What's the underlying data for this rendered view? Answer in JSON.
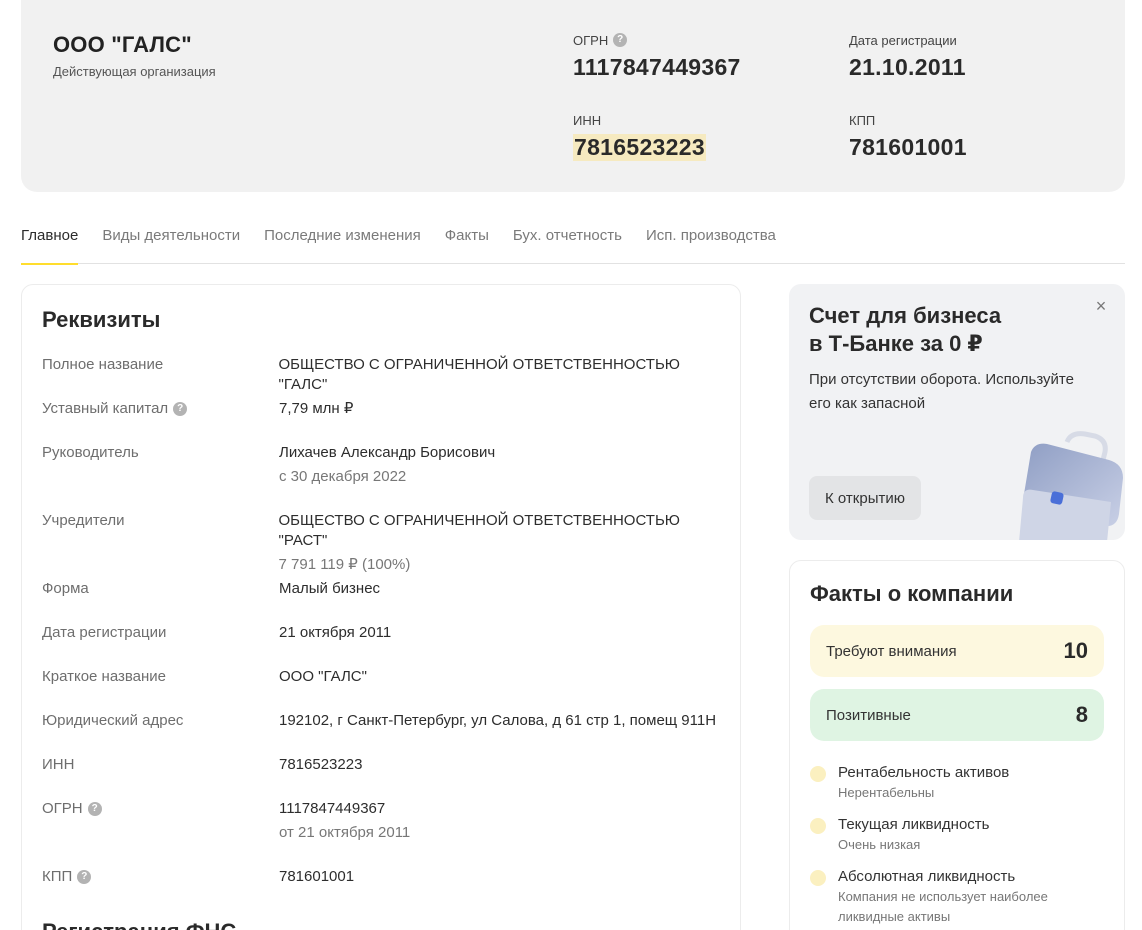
{
  "header": {
    "name": "ООО \"ГАЛС\"",
    "status": "Действующая организация",
    "ogrn_label": "ОГРН",
    "ogrn": "1117847449367",
    "reg_label": "Дата регистрации",
    "reg_date": "21.10.2011",
    "inn_label": "ИНН",
    "inn": "7816523223",
    "kpp_label": "КПП",
    "kpp": "781601001"
  },
  "tabs": [
    {
      "label": "Главное",
      "active": true
    },
    {
      "label": "Виды деятельности",
      "active": false
    },
    {
      "label": "Последние изменения",
      "active": false
    },
    {
      "label": "Факты",
      "active": false
    },
    {
      "label": "Бух. отчетность",
      "active": false
    },
    {
      "label": "Исп. производства",
      "active": false
    }
  ],
  "requisites": {
    "title": "Реквизиты",
    "rows": [
      {
        "label": "Полное название",
        "value": "ОБЩЕСТВО С ОГРАНИЧЕННОЙ ОТВЕТСТВЕННОСТЬЮ \"ГАЛС\""
      },
      {
        "label": "Уставный капитал",
        "value": "7,79 млн ₽"
      },
      {
        "label": "Руководитель",
        "value": "Лихачев Александр Борисович",
        "sub": "с 30 декабря 2022"
      },
      {
        "label": "Учредители",
        "value": "ОБЩЕСТВО С ОГРАНИЧЕННОЙ ОТВЕТСТВЕННОСТЬЮ \"РАСТ\"",
        "sub": "7 791 119 ₽ (100%)"
      },
      {
        "label": "Форма",
        "value": "Малый бизнес"
      },
      {
        "label": "Дата регистрации",
        "value": "21 октября 2011"
      },
      {
        "label": "Краткое название",
        "value": "ООО \"ГАЛС\""
      },
      {
        "label": "Юридический адрес",
        "value": "192102, г Санкт-Петербург, ул Салова, д 61 стр 1, помещ 911Н"
      },
      {
        "label": "ИНН",
        "value": "7816523223"
      },
      {
        "label": "ОГРН",
        "value": "1117847449367",
        "sub": "от 21 октября 2011"
      },
      {
        "label": "КПП",
        "value": "781601001"
      }
    ],
    "next_section": "Регистрация ФНС"
  },
  "promo": {
    "title_line1": "Счет для бизнеса",
    "title_line2": "в Т-Банке за 0 ₽",
    "text": "При отсутствии оборота. Используйте его как запасной",
    "button": "К открытию",
    "close": "×"
  },
  "facts": {
    "title": "Факты о компании",
    "attention_label": "Требуют внимания",
    "attention_count": "10",
    "positive_label": "Позитивные",
    "positive_count": "8",
    "items": [
      {
        "name": "Рентабельность активов",
        "desc": "Нерентабельны"
      },
      {
        "name": "Текущая ликвидность",
        "desc": "Очень низкая"
      },
      {
        "name": "Абсолютная ликвидность",
        "desc": "Компания не использует наиболее ликвидные активы"
      }
    ]
  },
  "colors": {
    "accent": "#ffdd2d",
    "highlight": "#f6eac0",
    "warn_bg": "#fdf8df",
    "positive_bg": "#dff4e3"
  },
  "icons": {
    "help": "question-circle-icon",
    "close": "close-icon",
    "briefcase": "briefcase-icon"
  }
}
